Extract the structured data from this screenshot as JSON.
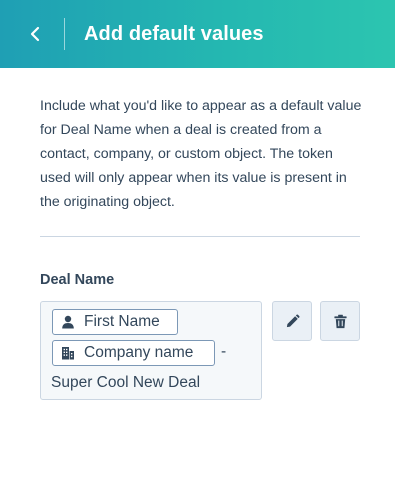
{
  "header": {
    "back_icon": "chevron-left-icon",
    "title": "Add default values",
    "gradient_colors": [
      "#1f9fb4",
      "#2cc5b0"
    ]
  },
  "description": "Include what you'd like to appear as a default value for Deal Name when a deal is created from a contact, company, or custom object. The token used will only appear when its value is present in the originating object.",
  "field": {
    "label": "Deal Name",
    "tokens": [
      {
        "icon": "contact-person-icon",
        "label": "First Name"
      },
      {
        "icon": "company-building-icon",
        "label": "Company name"
      }
    ],
    "separator": "-",
    "text": "Super Cool New Deal"
  },
  "actions": {
    "edit_icon": "pencil-icon",
    "delete_icon": "trash-icon"
  },
  "colors": {
    "text": "#33475b",
    "border": "#cbd6e2",
    "field_bg": "#f5f8fa",
    "button_bg": "#eaf0f6"
  }
}
